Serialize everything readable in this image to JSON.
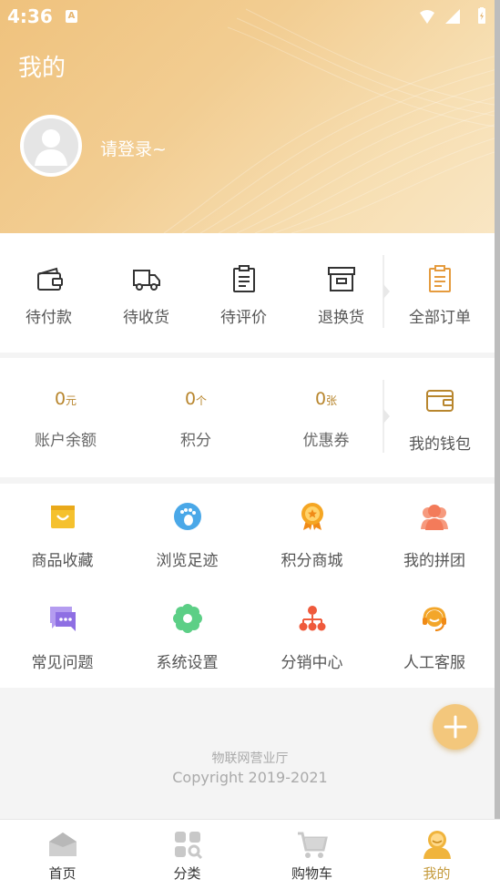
{
  "status_bar": {
    "time": "4:36",
    "notif": "A"
  },
  "header": {
    "title": "我的",
    "login_prompt": "请登录~"
  },
  "orders": [
    {
      "label": "待付款",
      "icon": "wallet-icon"
    },
    {
      "label": "待收货",
      "icon": "truck-icon"
    },
    {
      "label": "待评价",
      "icon": "clipboard-icon"
    },
    {
      "label": "退换货",
      "icon": "box-icon"
    },
    {
      "label": "全部订单",
      "icon": "orders-list-icon"
    }
  ],
  "wallet": {
    "balance": {
      "value": "0",
      "unit": "元",
      "label": "账户余额"
    },
    "points": {
      "value": "0",
      "unit": "个",
      "label": "积分"
    },
    "coupons": {
      "value": "0",
      "unit": "张",
      "label": "优惠券"
    },
    "my_wallet": {
      "label": "我的钱包",
      "icon": "purse-icon"
    }
  },
  "services": [
    {
      "label": "商品收藏",
      "icon": "favorites-bag-icon",
      "color": "#f5c12e"
    },
    {
      "label": "浏览足迹",
      "icon": "footprint-icon",
      "color": "#4aa8e8"
    },
    {
      "label": "积分商城",
      "icon": "medal-icon",
      "color": "#f39a1e"
    },
    {
      "label": "我的拼团",
      "icon": "group-icon",
      "color": "#f37b5a"
    },
    {
      "label": "常见问题",
      "icon": "chat-icon",
      "color": "#9a7be6"
    },
    {
      "label": "系统设置",
      "icon": "gear-flower-icon",
      "color": "#5ccf86"
    },
    {
      "label": "分销中心",
      "icon": "hierarchy-icon",
      "color": "#ef5a3c"
    },
    {
      "label": "人工客服",
      "icon": "headset-icon",
      "color": "#f3a62a"
    }
  ],
  "footer": {
    "line1": "物联网营业厅",
    "line2": "Copyright 2019-2021"
  },
  "tabs": [
    {
      "label": "首页",
      "icon": "home-icon"
    },
    {
      "label": "分类",
      "icon": "category-icon"
    },
    {
      "label": "购物车",
      "icon": "cart-icon"
    },
    {
      "label": "我的",
      "icon": "profile-icon",
      "active": true
    }
  ],
  "accent_color": "#c49a3c"
}
